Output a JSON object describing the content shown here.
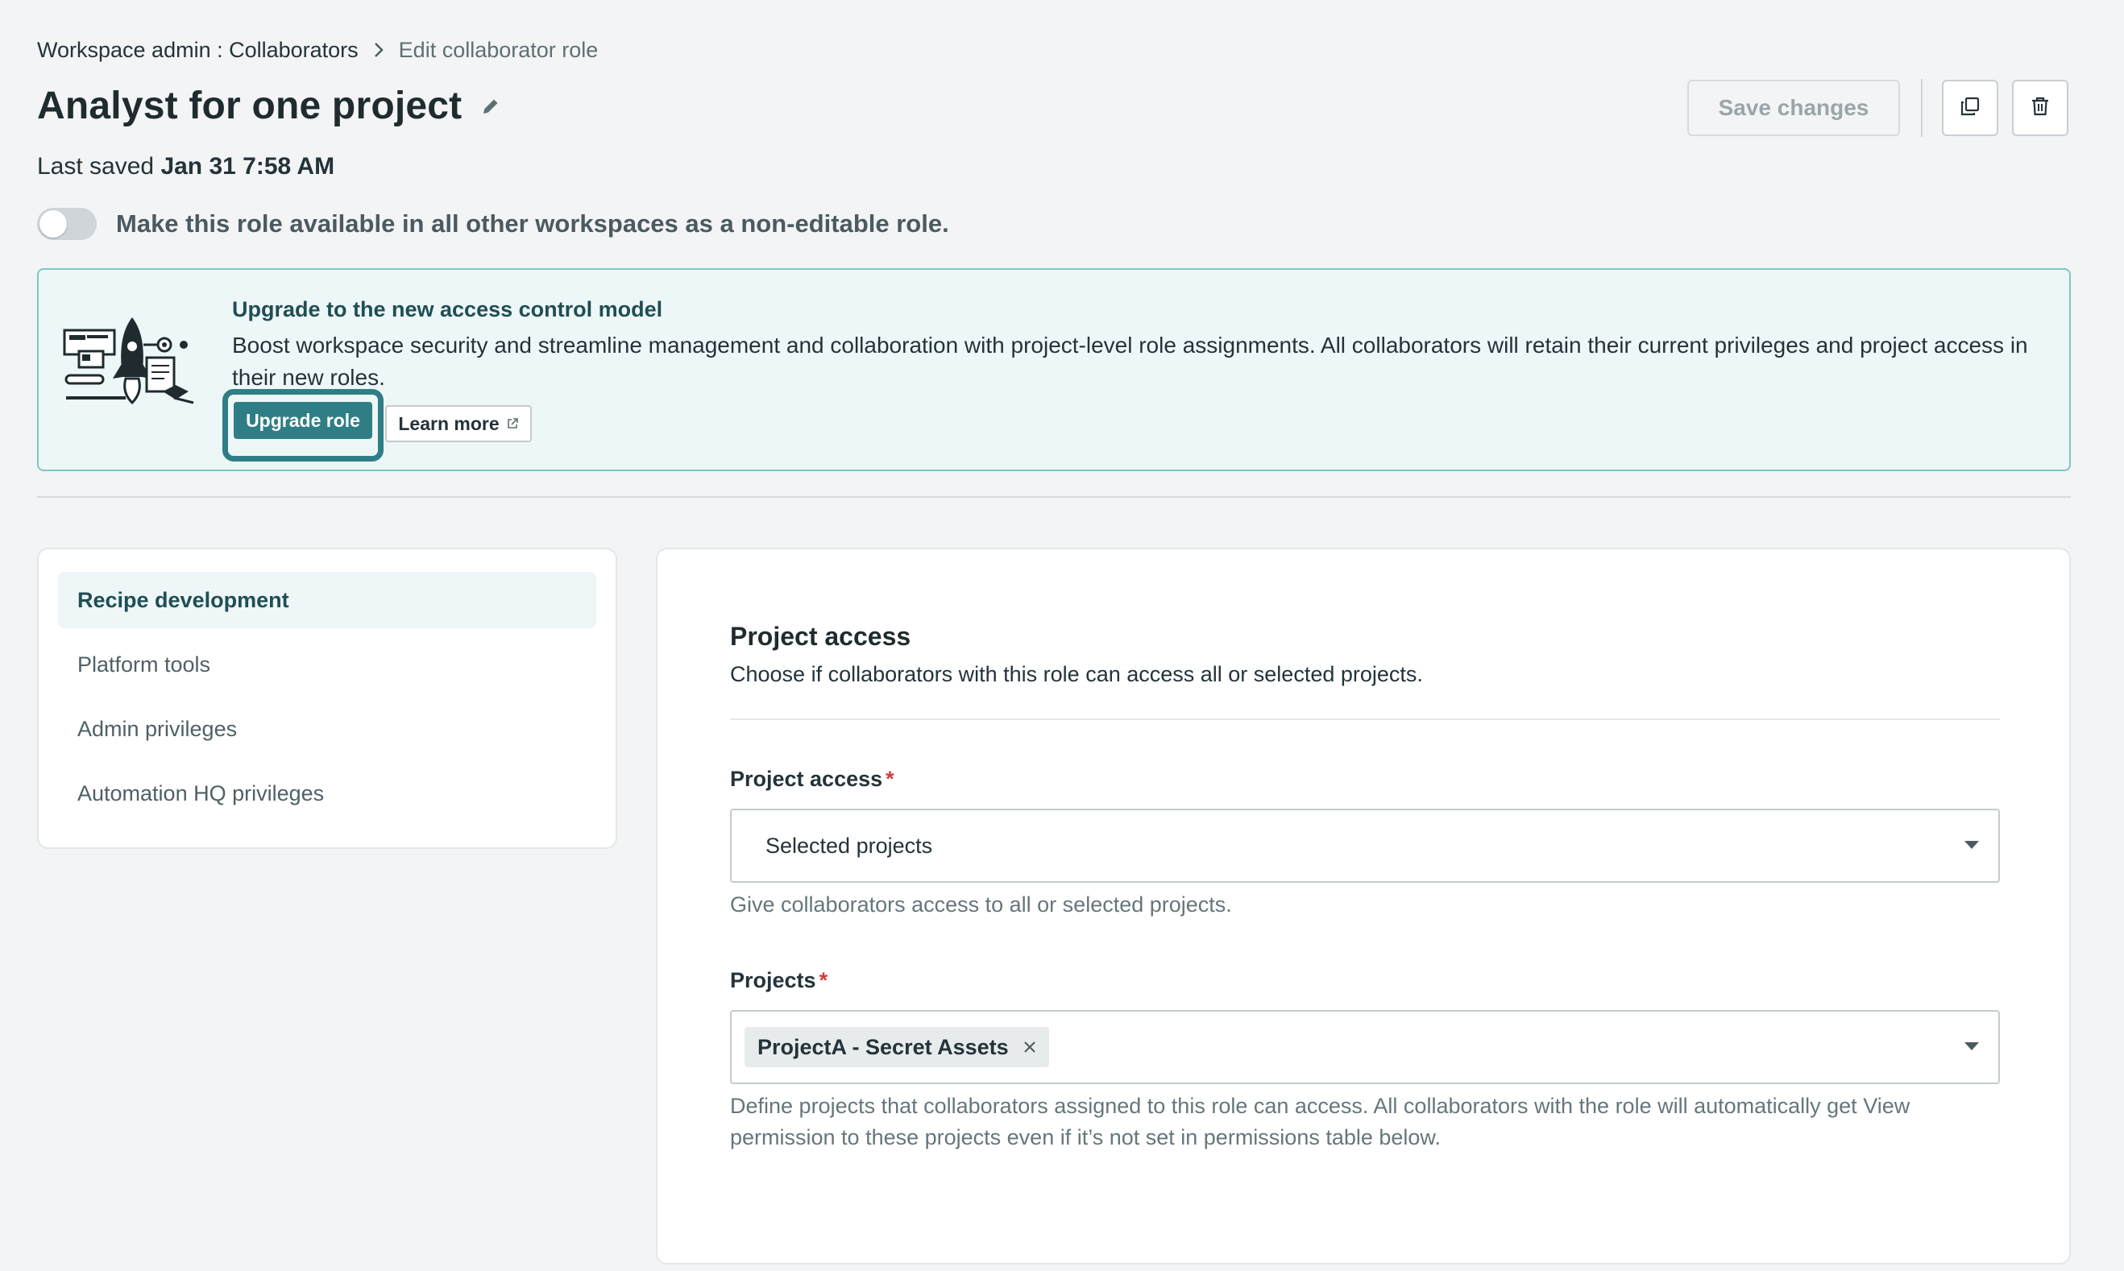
{
  "breadcrumb": {
    "parent": "Workspace admin : Collaborators",
    "current": "Edit collaborator role"
  },
  "header": {
    "title": "Analyst for one project",
    "last_saved_label": "Last saved",
    "last_saved_value": "Jan 31 7:58 AM",
    "save_label": "Save changes"
  },
  "availability_toggle": {
    "label": "Make this role available in all other workspaces as a non-editable role.",
    "enabled": false
  },
  "banner": {
    "title": "Upgrade to the new access control model",
    "text": "Boost workspace security and streamline management and collaboration with project-level role assignments. All collaborators will retain their current privileges and project access in their new roles.",
    "upgrade_label": "Upgrade role",
    "learn_more_label": "Learn more"
  },
  "sidebar": {
    "items": [
      {
        "label": "Recipe development",
        "active": true
      },
      {
        "label": "Platform tools",
        "active": false
      },
      {
        "label": "Admin privileges",
        "active": false
      },
      {
        "label": "Automation HQ privileges",
        "active": false
      }
    ]
  },
  "main": {
    "section_title": "Project access",
    "section_subtitle": "Choose if collaborators with this role can access all or selected projects.",
    "project_access": {
      "label": "Project access",
      "required_mark": "*",
      "value": "Selected projects",
      "help": "Give collaborators access to all or selected projects."
    },
    "projects": {
      "label": "Projects",
      "required_mark": "*",
      "tags": [
        "ProjectA - Secret Assets"
      ],
      "help": "Define projects that collaborators assigned to this role can access. All collaborators with the role will automatically get View permission to these projects even if it’s not set in permissions table below."
    }
  },
  "colors": {
    "accent": "#2f7e86",
    "banner_border": "#7fc7c3",
    "banner_bg": "#eef7f7",
    "required": "#d33b3b",
    "page_bg": "#f3f4f5"
  },
  "icons": [
    "chevron-right-icon",
    "pencil-icon",
    "copy-icon",
    "trash-icon",
    "external-link-icon",
    "close-icon",
    "caret-down-icon",
    "rocket-illustration"
  ]
}
